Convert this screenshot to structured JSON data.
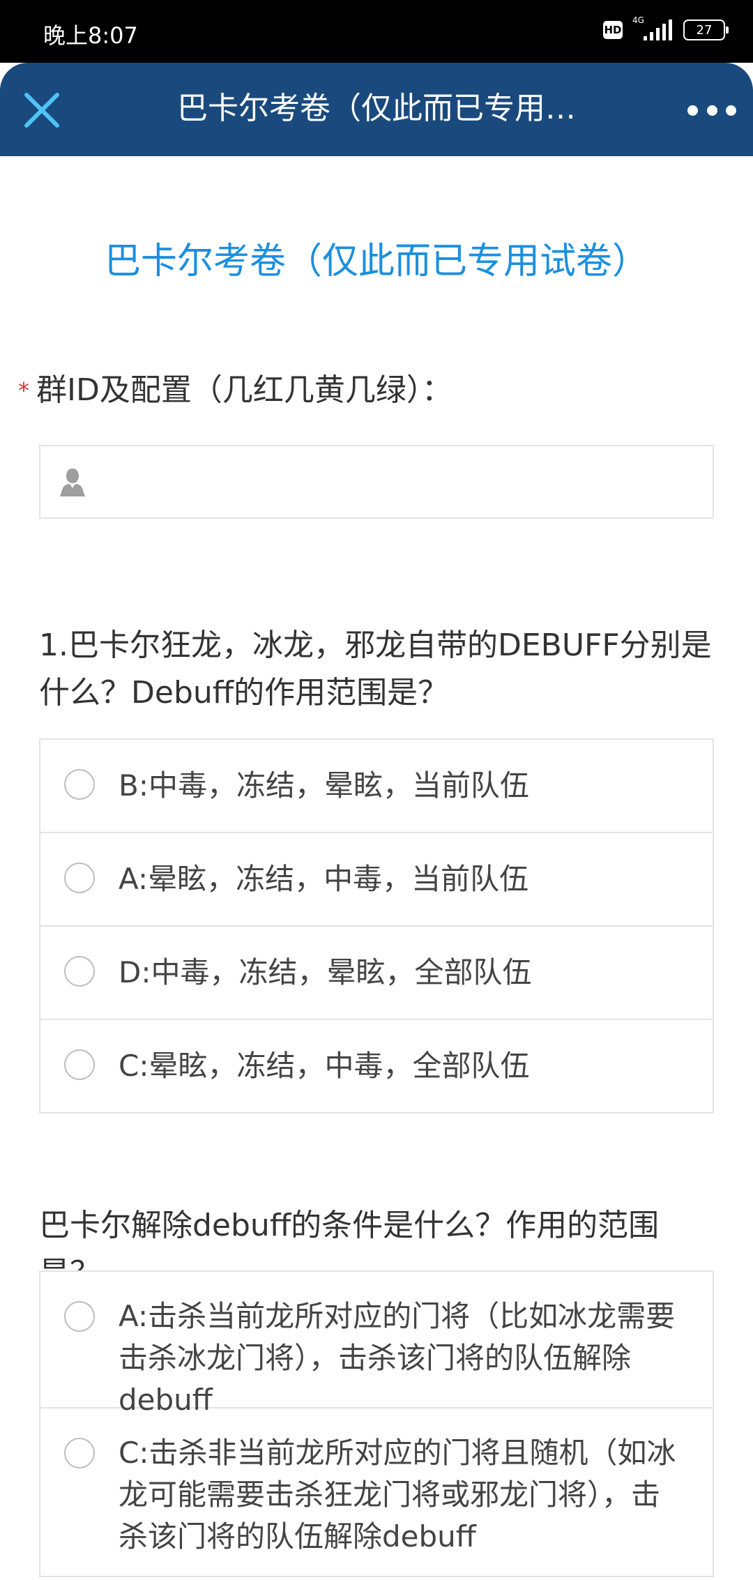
{
  "status_bar": {
    "time": "晚上8:07",
    "hd_label": "HD",
    "network_label": "4G",
    "battery_level": "27"
  },
  "nav": {
    "title": "巴卡尔考卷（仅此而已专用…",
    "close_icon": "close-icon",
    "more_icon": "more-dots-icon"
  },
  "form": {
    "title": "巴卡尔考卷（仅此而已专用试卷）",
    "field": {
      "required_mark": "*",
      "label": "群ID及配置（几红几黄几绿）：",
      "value": "",
      "placeholder": "",
      "icon": "person-icon"
    },
    "questions": [
      {
        "text": "1.巴卡尔狂龙，冰龙，邪龙自带的DEBUFF分别是什么？Debuff的作用范围是？",
        "options": [
          "B:中毒，冻结，晕眩，当前队伍",
          "A:晕眩，冻结，中毒，当前队伍",
          "D:中毒，冻结，晕眩，全部队伍",
          "C:晕眩，冻结，中毒，全部队伍"
        ]
      },
      {
        "text": "巴卡尔解除debuff的条件是什么？作用的范围是？",
        "options": [
          "A:击杀当前龙所对应的门将（比如冰龙需要击杀冰龙门将），击杀该门将的队伍解除debuff",
          "C:击杀非当前龙所对应的门将且随机（如冰龙可能需要击杀狂龙门将或邪龙门将），击杀该门将的队伍解除debuff"
        ]
      }
    ]
  },
  "colors": {
    "nav_bg": "#1a4a7d",
    "accent": "#1b8fe0",
    "close_icon": "#4fc3f7",
    "required": "#e03030"
  }
}
